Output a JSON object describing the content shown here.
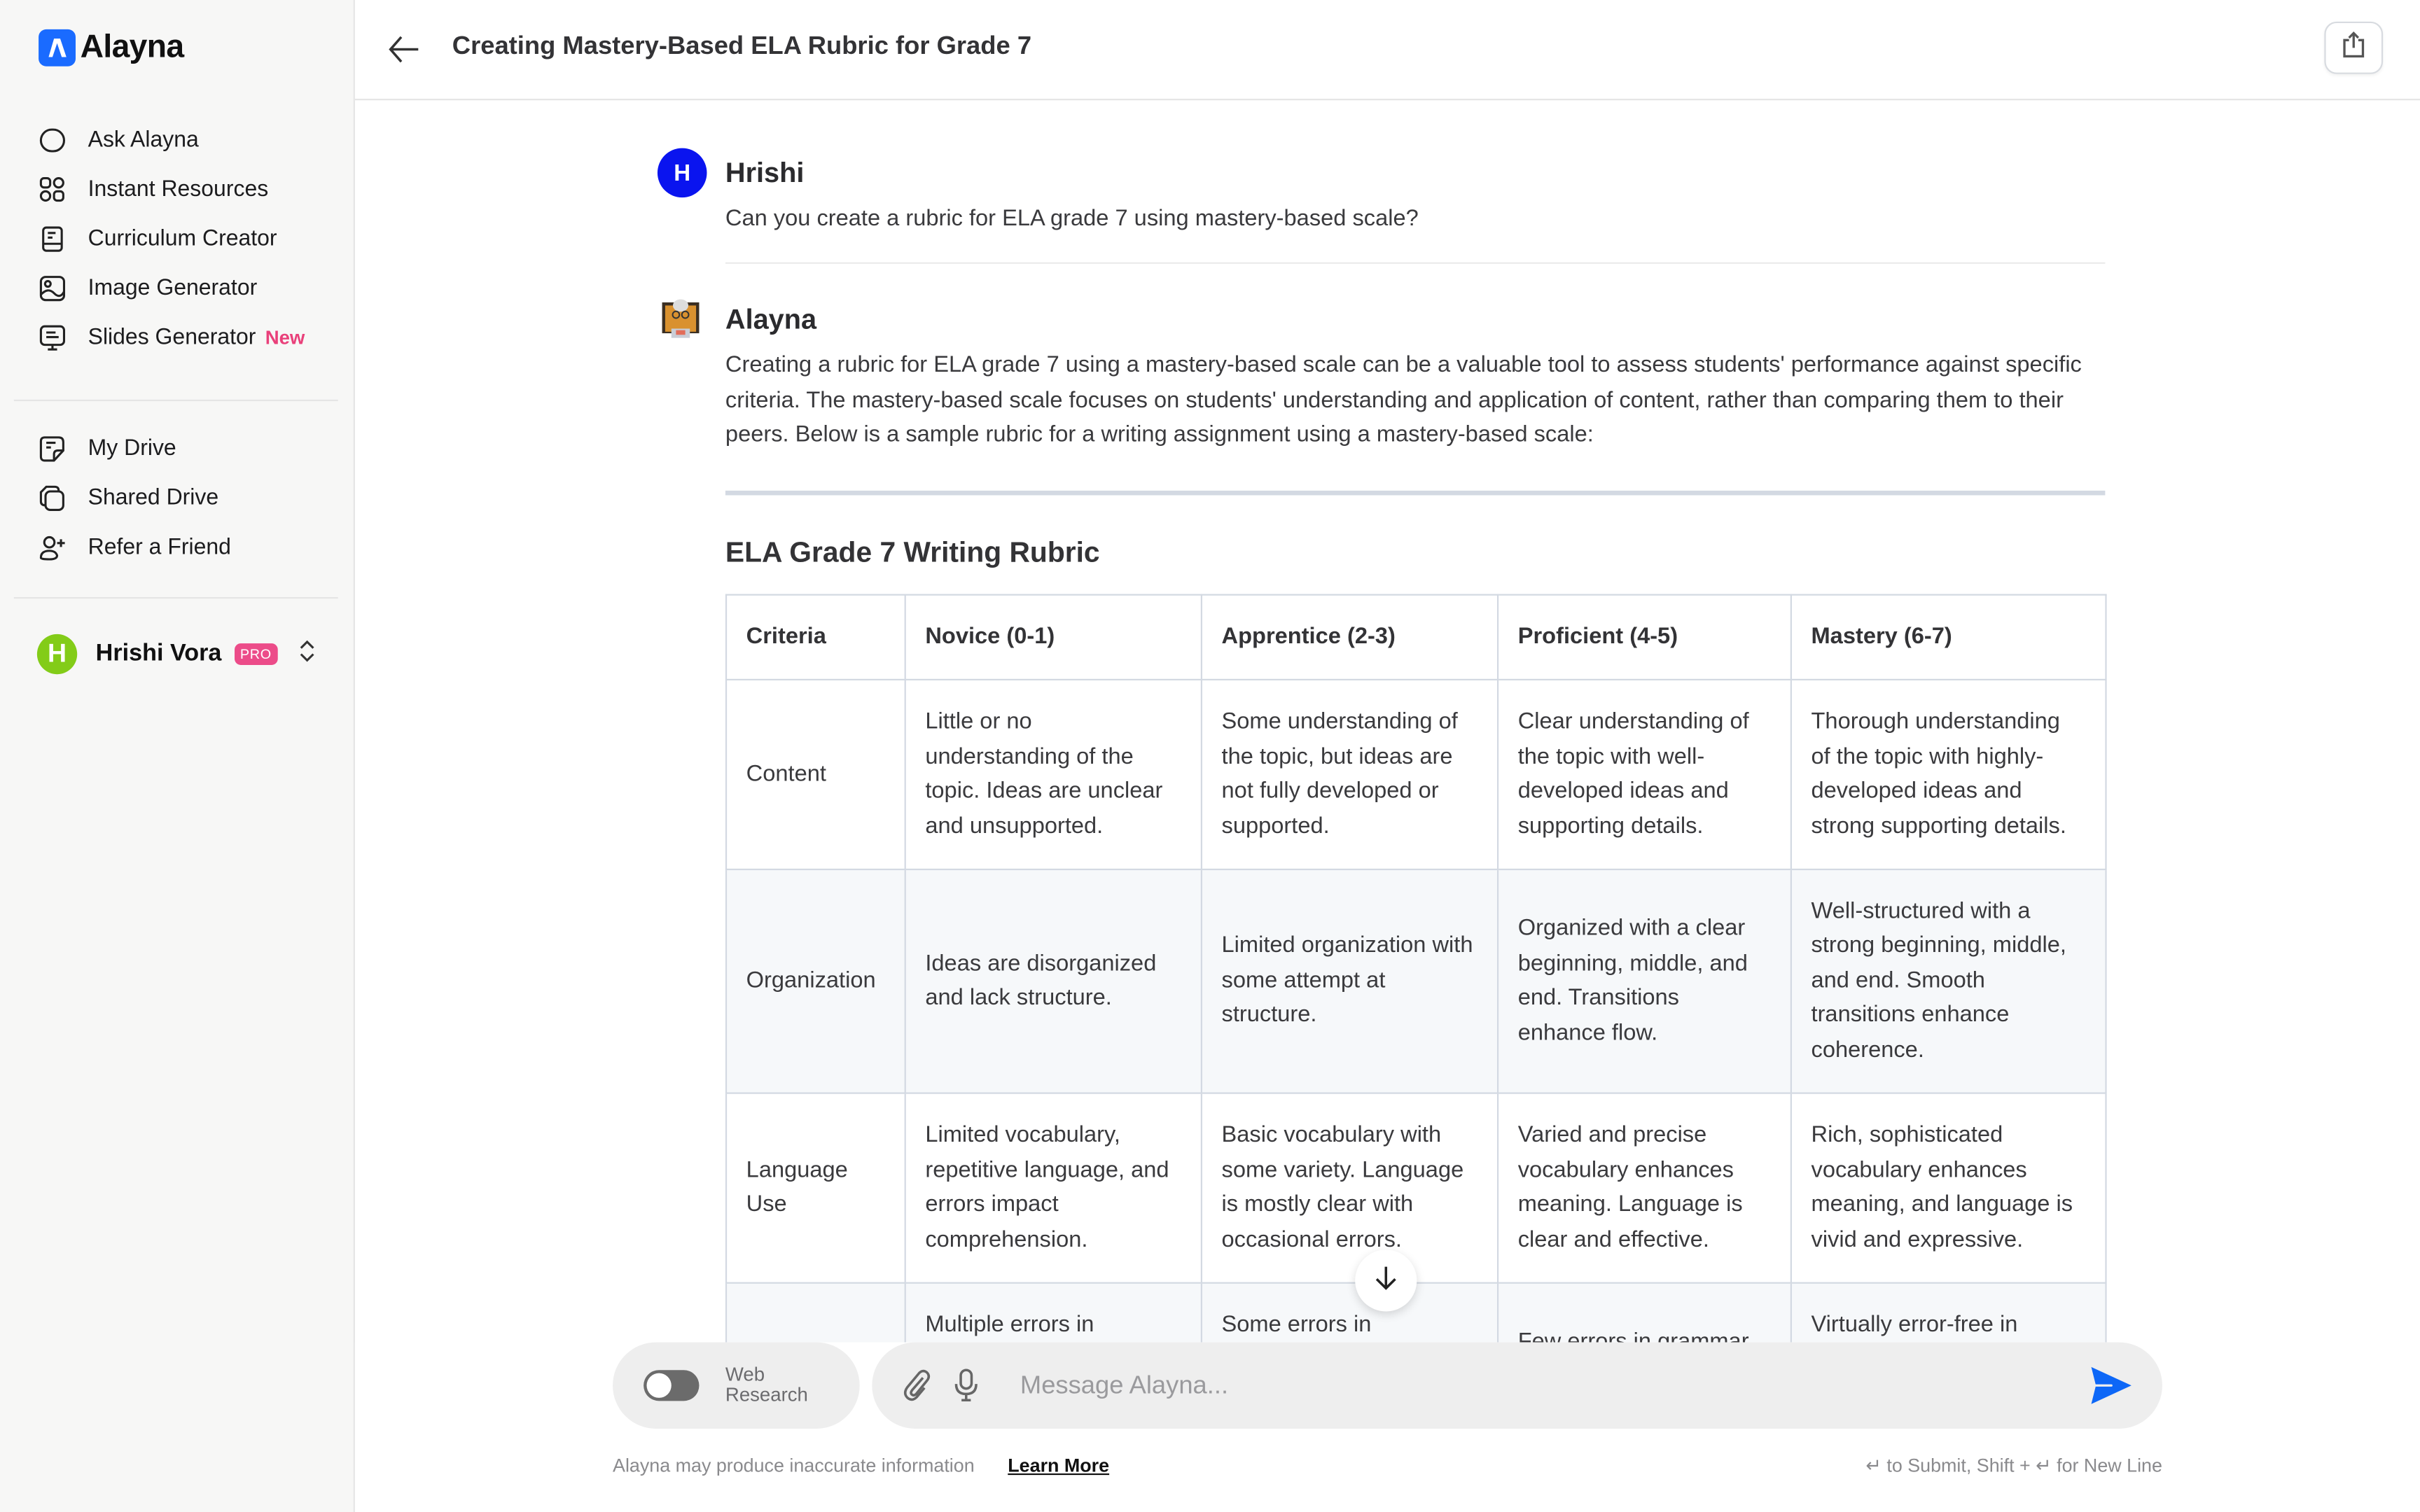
{
  "app": {
    "name": "Alayna",
    "brand_color": "#1a6bff",
    "accent_pink": "#ec4c89"
  },
  "sidebar": {
    "primary_items": [
      {
        "label": "Ask Alayna",
        "icon": "chat-bubble-icon"
      },
      {
        "label": "Instant Resources",
        "icon": "grid-icon"
      },
      {
        "label": "Curriculum Creator",
        "icon": "book-icon"
      },
      {
        "label": "Image Generator",
        "icon": "image-icon"
      },
      {
        "label": "Slides Generator",
        "icon": "monitor-icon",
        "badge": "New"
      }
    ],
    "secondary_items": [
      {
        "label": "My Drive",
        "icon": "note-icon"
      },
      {
        "label": "Shared Drive",
        "icon": "stacked-docs-icon"
      },
      {
        "label": "Refer a Friend",
        "icon": "user-plus-icon"
      }
    ],
    "user": {
      "initial": "H",
      "name": "Hrishi Vora",
      "plan_badge": "PRO",
      "avatar_color": "#83cc18"
    }
  },
  "header": {
    "title": "Creating Mastery-Based ELA Rubric for Grade 7",
    "back_icon": "arrow-left-icon",
    "share_icon": "share-icon"
  },
  "conversation": {
    "user_message": {
      "initial": "H",
      "sender": "Hrishi",
      "text": "Can you create a rubric for ELA grade 7 using mastery-based scale?"
    },
    "assistant_message": {
      "sender": "Alayna",
      "intro": "Creating a rubric for ELA grade 7 using a mastery-based scale can be a valuable tool to assess students' performance against specific criteria. The mastery-based scale focuses on students' understanding and application of content, rather than comparing them to their peers. Below is a sample rubric for a writing assignment using a mastery-based scale:",
      "rubric_title": "ELA Grade 7 Writing Rubric",
      "table": {
        "headers": [
          "Criteria",
          "Novice (0-1)",
          "Apprentice (2-3)",
          "Proficient (4-5)",
          "Mastery (6-7)"
        ],
        "rows": [
          [
            "Content",
            "Little or no understanding of the topic. Ideas are unclear and unsupported.",
            "Some understanding of the topic, but ideas are not fully developed or supported.",
            "Clear understanding of the topic with well-developed ideas and supporting details.",
            "Thorough understanding of the topic with highly-developed ideas and strong supporting details."
          ],
          [
            "Organization",
            "Ideas are disorganized and lack structure.",
            "Limited organization with some attempt at structure.",
            "Organized with a clear beginning, middle, and end. Transitions enhance flow.",
            "Well-structured with a strong beginning, middle, and end. Smooth transitions enhance coherence."
          ],
          [
            "Language Use",
            "Limited vocabulary, repetitive language, and errors impact comprehension.",
            "Basic vocabulary with some variety. Language is mostly clear with occasional errors.",
            "Varied and precise vocabulary enhances meaning. Language is clear and effective.",
            "Rich, sophisticated vocabulary enhances meaning, and language is vivid and expressive."
          ],
          [
            "",
            "Multiple errors in",
            "Some errors in",
            "Few errors in grammar",
            "Virtually error-free in"
          ]
        ]
      }
    }
  },
  "composer": {
    "web_research_label_1": "Web",
    "web_research_label_2": "Research",
    "web_research_enabled": false,
    "placeholder": "Message Alayna...",
    "value": "",
    "disclaimer": "Alayna may produce inaccurate information",
    "learn_more": "Learn More",
    "hint": "↵ to Submit, Shift + ↵ for New Line"
  }
}
